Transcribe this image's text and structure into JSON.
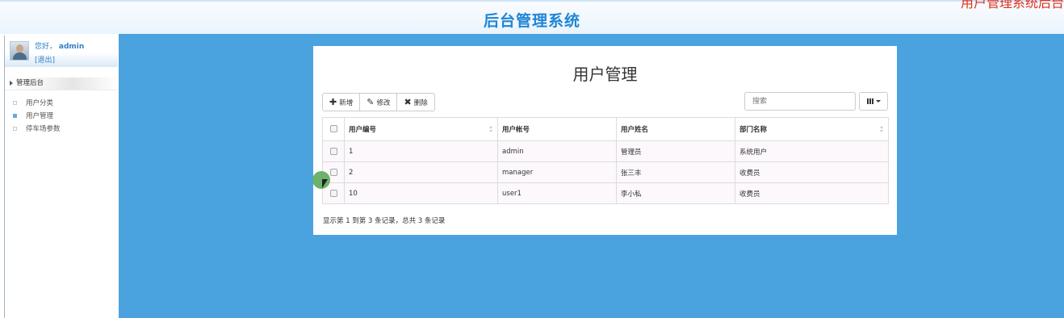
{
  "header": {
    "title": "后台管理系统",
    "corner_text": "用户管理系统后台"
  },
  "sidebar": {
    "greeting": "您好，",
    "username": "admin",
    "logout": "[退出]",
    "menu_title": "管理后台",
    "items": [
      {
        "label": "用户分类",
        "active": false
      },
      {
        "label": "用户管理",
        "active": true
      },
      {
        "label": "停车场参数",
        "active": false
      }
    ]
  },
  "panel": {
    "title": "用户管理",
    "toolbar": {
      "add": "新增",
      "edit": "修改",
      "delete": "删除"
    },
    "search": {
      "placeholder": "搜索"
    },
    "table": {
      "columns": [
        "用户编号",
        "用户帐号",
        "用户姓名",
        "部门名称"
      ],
      "rows": [
        [
          "1",
          "admin",
          "管理员",
          "系统用户"
        ],
        [
          "2",
          "manager",
          "张三丰",
          "收费员"
        ],
        [
          "10",
          "user1",
          "李小私",
          "收费员"
        ]
      ]
    },
    "pagination_info": "显示第 1 到第 3 条记录，总共 3 条记录"
  },
  "colors": {
    "main_bg": "#4aa3df",
    "title_blue": "#1f85d4",
    "link_blue": "#2f7fc6"
  }
}
